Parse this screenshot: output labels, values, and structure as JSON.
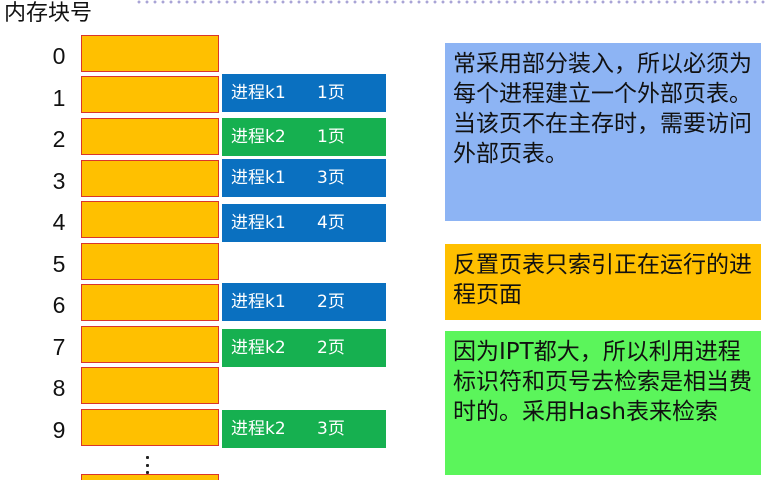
{
  "header": {
    "label": "内存块号"
  },
  "blocks": [
    {
      "num": "0",
      "entry": null
    },
    {
      "num": "1",
      "entry": {
        "process": "进程k1",
        "page": "1页",
        "color": "#0a70c0"
      }
    },
    {
      "num": "2",
      "entry": {
        "process": "进程k2",
        "page": "1页",
        "color": "#16b050"
      }
    },
    {
      "num": "3",
      "entry": {
        "process": "进程k1",
        "page": "3页",
        "color": "#0a70c0"
      }
    },
    {
      "num": "4",
      "entry": {
        "process": "进程k1",
        "page": "4页",
        "color": "#0a70c0"
      }
    },
    {
      "num": "5",
      "entry": null
    },
    {
      "num": "6",
      "entry": {
        "process": "进程k1",
        "page": "2页",
        "color": "#0a70c0"
      }
    },
    {
      "num": "7",
      "entry": {
        "process": "进程k2",
        "page": "2页",
        "color": "#16b050"
      }
    },
    {
      "num": "8",
      "entry": null
    },
    {
      "num": "9",
      "entry": {
        "process": "进程k2",
        "page": "3页",
        "color": "#16b050"
      }
    }
  ],
  "notes": [
    {
      "text": "常采用部分装入，所以必须为每个进程建立一个外部页表。当该页不在主存时，需要访问外部页表。",
      "color": "#8db4f4"
    },
    {
      "text": "反置页表只索引正在运行的进程页面",
      "color": "#ffc000"
    },
    {
      "text": "因为IPT都大，所以利用进程标识符和页号去检索是相当费时的。采用Hash表来检索",
      "color": "#5bf55b"
    }
  ],
  "colors": {
    "block_fill": "#ffc000",
    "block_border": "#d9362b",
    "k1": "#0a70c0",
    "k2": "#16b050"
  }
}
